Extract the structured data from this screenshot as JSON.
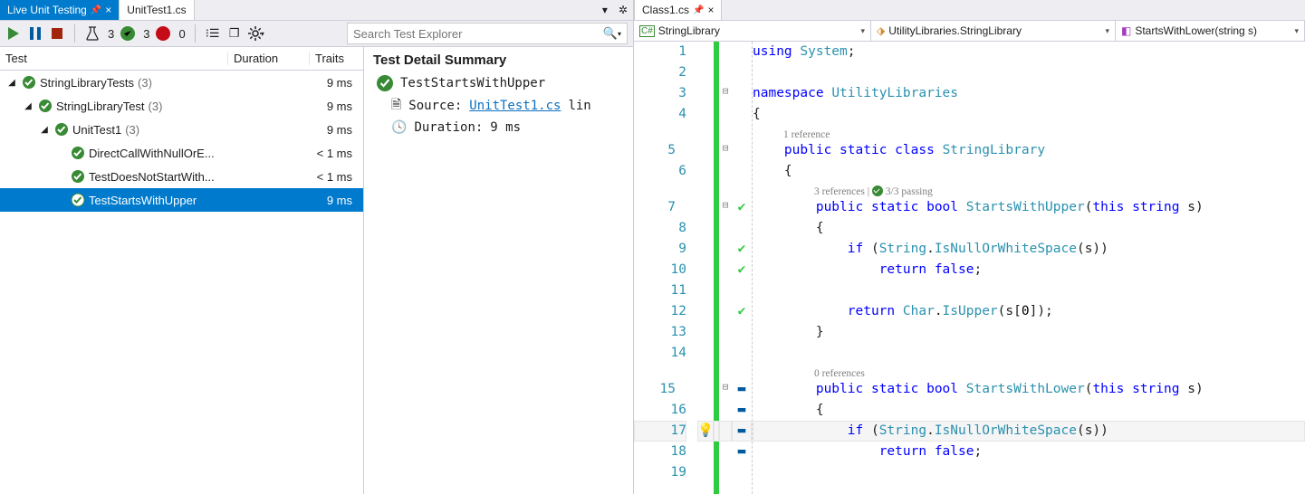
{
  "tabs_left": {
    "live_unit_testing": "Live Unit Testing",
    "file": "UnitTest1.cs"
  },
  "toolbar": {
    "flask_count": "3",
    "pass_count": "3",
    "fail_count": "0",
    "search_placeholder": "Search Test Explorer"
  },
  "tree": {
    "headers": {
      "test": "Test",
      "duration": "Duration",
      "traits": "Traits"
    },
    "items": [
      {
        "indent": 0,
        "caret": "◢",
        "name": "StringLibraryTests",
        "count": "(3)",
        "dur": "9 ms"
      },
      {
        "indent": 1,
        "caret": "◢",
        "name": "StringLibraryTest",
        "count": "(3)",
        "dur": "9 ms"
      },
      {
        "indent": 2,
        "caret": "◢",
        "name": "UnitTest1",
        "count": "(3)",
        "dur": "9 ms"
      },
      {
        "indent": 3,
        "caret": "",
        "name": "DirectCallWithNullOrE...",
        "count": "",
        "dur": "< 1 ms"
      },
      {
        "indent": 3,
        "caret": "",
        "name": "TestDoesNotStartWith...",
        "count": "",
        "dur": "< 1 ms"
      },
      {
        "indent": 3,
        "caret": "",
        "name": "TestStartsWithUpper",
        "count": "",
        "dur": "9 ms",
        "sel": true
      }
    ]
  },
  "detail": {
    "title": "Test Detail Summary",
    "test_name": "TestStartsWithUpper",
    "source_label": "Source:",
    "source_file": "UnitTest1.cs",
    "source_suffix": "lin",
    "duration_label": "Duration:",
    "duration_value": "9 ms"
  },
  "editor": {
    "tab": "Class1.cs",
    "nav": {
      "a": "StringLibrary",
      "b": "UtilityLibraries.StringLibrary",
      "c": "StartsWithLower(string s)"
    },
    "codelens1": "1 reference",
    "codelens2a": "3 references",
    "codelens2b": "3/3 passing",
    "codelens3": "0 references",
    "lines": [
      {
        "n": "1",
        "code": "using System;"
      },
      {
        "n": "2",
        "code": ""
      },
      {
        "n": "3",
        "fold": "⊟",
        "code": "namespace UtilityLibraries"
      },
      {
        "n": "4",
        "code": "{"
      },
      {
        "n": "5",
        "fold": "⊟",
        "tall": true,
        "lens": "1",
        "code": "    public static class StringLibrary"
      },
      {
        "n": "6",
        "code": "    {"
      },
      {
        "n": "7",
        "fold": "⊟",
        "stat": "check",
        "tall": true,
        "lens": "2",
        "code": "        public static bool StartsWithUpper(this string s)"
      },
      {
        "n": "8",
        "code": "        {"
      },
      {
        "n": "9",
        "stat": "check",
        "code": "            if (String.IsNullOrWhiteSpace(s))"
      },
      {
        "n": "10",
        "stat": "check",
        "code": "                return false;"
      },
      {
        "n": "11",
        "code": ""
      },
      {
        "n": "12",
        "stat": "check",
        "code": "            return Char.IsUpper(s[0]);"
      },
      {
        "n": "13",
        "code": "        }"
      },
      {
        "n": "14",
        "code": ""
      },
      {
        "n": "15",
        "fold": "⊟",
        "stat": "dash",
        "tall": true,
        "lens": "3",
        "code": "        public static bool StartsWithLower(this string s)"
      },
      {
        "n": "16",
        "stat": "dash",
        "code": "        {"
      },
      {
        "n": "17",
        "bulb": true,
        "stat": "dash",
        "hl": true,
        "code": "            if (String.IsNullOrWhiteSpace(s))"
      },
      {
        "n": "18",
        "stat": "dash",
        "code": "                return false;"
      },
      {
        "n": "19",
        "code": ""
      }
    ]
  }
}
